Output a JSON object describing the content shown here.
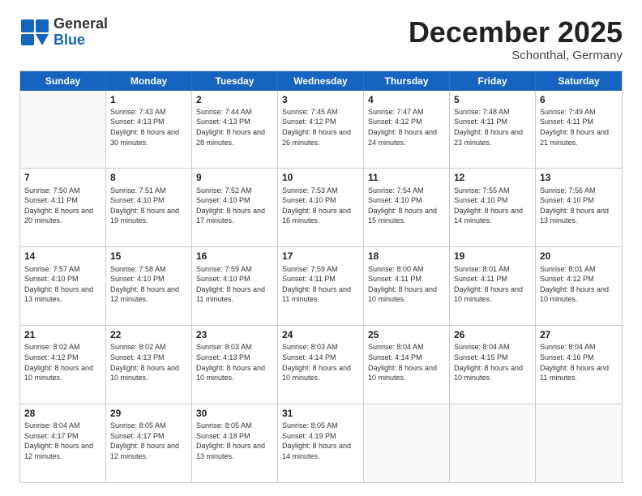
{
  "header": {
    "logo_line1": "General",
    "logo_line2": "Blue",
    "month_title": "December 2025",
    "location": "Schonthal, Germany"
  },
  "weekdays": [
    "Sunday",
    "Monday",
    "Tuesday",
    "Wednesday",
    "Thursday",
    "Friday",
    "Saturday"
  ],
  "rows": [
    [
      {
        "day": "",
        "empty": true
      },
      {
        "day": "1",
        "rise": "7:43 AM",
        "set": "4:13 PM",
        "daylight": "8 hours and 30 minutes."
      },
      {
        "day": "2",
        "rise": "7:44 AM",
        "set": "4:13 PM",
        "daylight": "8 hours and 28 minutes."
      },
      {
        "day": "3",
        "rise": "7:45 AM",
        "set": "4:12 PM",
        "daylight": "8 hours and 26 minutes."
      },
      {
        "day": "4",
        "rise": "7:47 AM",
        "set": "4:12 PM",
        "daylight": "8 hours and 24 minutes."
      },
      {
        "day": "5",
        "rise": "7:48 AM",
        "set": "4:11 PM",
        "daylight": "8 hours and 23 minutes."
      },
      {
        "day": "6",
        "rise": "7:49 AM",
        "set": "4:11 PM",
        "daylight": "8 hours and 21 minutes."
      }
    ],
    [
      {
        "day": "7",
        "rise": "7:50 AM",
        "set": "4:11 PM",
        "daylight": "8 hours and 20 minutes."
      },
      {
        "day": "8",
        "rise": "7:51 AM",
        "set": "4:10 PM",
        "daylight": "8 hours and 19 minutes."
      },
      {
        "day": "9",
        "rise": "7:52 AM",
        "set": "4:10 PM",
        "daylight": "8 hours and 17 minutes."
      },
      {
        "day": "10",
        "rise": "7:53 AM",
        "set": "4:10 PM",
        "daylight": "8 hours and 16 minutes."
      },
      {
        "day": "11",
        "rise": "7:54 AM",
        "set": "4:10 PM",
        "daylight": "8 hours and 15 minutes."
      },
      {
        "day": "12",
        "rise": "7:55 AM",
        "set": "4:10 PM",
        "daylight": "8 hours and 14 minutes."
      },
      {
        "day": "13",
        "rise": "7:56 AM",
        "set": "4:10 PM",
        "daylight": "8 hours and 13 minutes."
      }
    ],
    [
      {
        "day": "14",
        "rise": "7:57 AM",
        "set": "4:10 PM",
        "daylight": "8 hours and 13 minutes."
      },
      {
        "day": "15",
        "rise": "7:58 AM",
        "set": "4:10 PM",
        "daylight": "8 hours and 12 minutes."
      },
      {
        "day": "16",
        "rise": "7:59 AM",
        "set": "4:10 PM",
        "daylight": "8 hours and 11 minutes."
      },
      {
        "day": "17",
        "rise": "7:59 AM",
        "set": "4:11 PM",
        "daylight": "8 hours and 11 minutes."
      },
      {
        "day": "18",
        "rise": "8:00 AM",
        "set": "4:11 PM",
        "daylight": "8 hours and 10 minutes."
      },
      {
        "day": "19",
        "rise": "8:01 AM",
        "set": "4:11 PM",
        "daylight": "8 hours and 10 minutes."
      },
      {
        "day": "20",
        "rise": "8:01 AM",
        "set": "4:12 PM",
        "daylight": "8 hours and 10 minutes."
      }
    ],
    [
      {
        "day": "21",
        "rise": "8:02 AM",
        "set": "4:12 PM",
        "daylight": "8 hours and 10 minutes."
      },
      {
        "day": "22",
        "rise": "8:02 AM",
        "set": "4:13 PM",
        "daylight": "8 hours and 10 minutes."
      },
      {
        "day": "23",
        "rise": "8:03 AM",
        "set": "4:13 PM",
        "daylight": "8 hours and 10 minutes."
      },
      {
        "day": "24",
        "rise": "8:03 AM",
        "set": "4:14 PM",
        "daylight": "8 hours and 10 minutes."
      },
      {
        "day": "25",
        "rise": "8:04 AM",
        "set": "4:14 PM",
        "daylight": "8 hours and 10 minutes."
      },
      {
        "day": "26",
        "rise": "8:04 AM",
        "set": "4:15 PM",
        "daylight": "8 hours and 10 minutes."
      },
      {
        "day": "27",
        "rise": "8:04 AM",
        "set": "4:16 PM",
        "daylight": "8 hours and 11 minutes."
      }
    ],
    [
      {
        "day": "28",
        "rise": "8:04 AM",
        "set": "4:17 PM",
        "daylight": "8 hours and 12 minutes."
      },
      {
        "day": "29",
        "rise": "8:05 AM",
        "set": "4:17 PM",
        "daylight": "8 hours and 12 minutes."
      },
      {
        "day": "30",
        "rise": "8:05 AM",
        "set": "4:18 PM",
        "daylight": "8 hours and 13 minutes."
      },
      {
        "day": "31",
        "rise": "8:05 AM",
        "set": "4:19 PM",
        "daylight": "8 hours and 14 minutes."
      },
      {
        "day": "",
        "empty": true
      },
      {
        "day": "",
        "empty": true
      },
      {
        "day": "",
        "empty": true
      }
    ]
  ]
}
